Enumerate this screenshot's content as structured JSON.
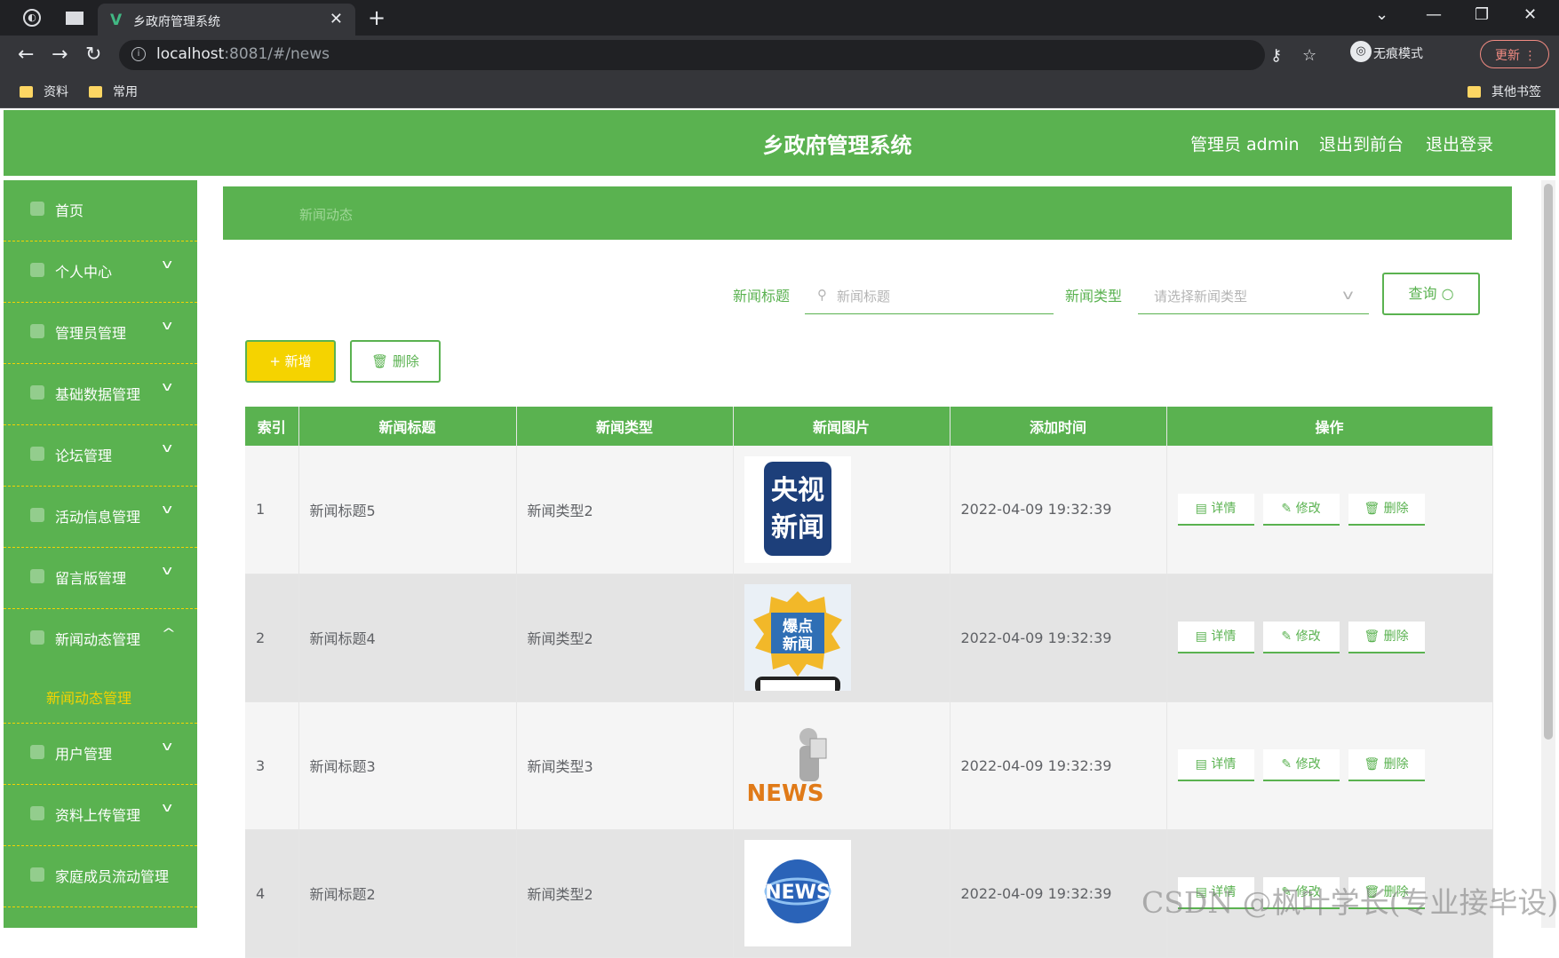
{
  "browser": {
    "tab_title": "乡政府管理系统",
    "url_host": "localhost",
    "url_rest": ":8081/#/news",
    "incognito_label": "无痕模式",
    "update_label": "更新",
    "bookmarks": [
      "资料",
      "常用"
    ],
    "other_bookmarks": "其他书签"
  },
  "header": {
    "title": "乡政府管理系统",
    "admin_label": "管理员 admin",
    "front_label": "退出到前台",
    "logout_label": "退出登录"
  },
  "sidebar": {
    "items": [
      {
        "label": "首页"
      },
      {
        "label": "个人中心"
      },
      {
        "label": "管理员管理"
      },
      {
        "label": "基础数据管理"
      },
      {
        "label": "论坛管理"
      },
      {
        "label": "活动信息管理"
      },
      {
        "label": "留言版管理"
      },
      {
        "label": "新闻动态管理"
      },
      {
        "label": "用户管理"
      },
      {
        "label": "资料上传管理"
      },
      {
        "label": "家庭成员流动管理"
      }
    ],
    "sub_item": "新闻动态管理"
  },
  "breadcrumb": "新闻动态",
  "search": {
    "title_label": "新闻标题",
    "title_placeholder": "新闻标题",
    "type_label": "新闻类型",
    "type_placeholder": "请选择新闻类型",
    "query_label": "查询"
  },
  "actions": {
    "add_label": "+ 新增",
    "delete_label": "删除"
  },
  "table": {
    "headers": [
      "索引",
      "新闻标题",
      "新闻类型",
      "新闻图片",
      "添加时间",
      "操作"
    ],
    "rows": [
      {
        "index": "1",
        "title": "新闻标题5",
        "type": "新闻类型2",
        "image": "央视新闻",
        "time": "2022-04-09 19:32:39"
      },
      {
        "index": "2",
        "title": "新闻标题4",
        "type": "新闻类型2",
        "image": "爆点新闻",
        "time": "2022-04-09 19:32:39"
      },
      {
        "index": "3",
        "title": "新闻标题3",
        "type": "新闻类型3",
        "image": "NEWS",
        "time": "2022-04-09 19:32:39"
      },
      {
        "index": "4",
        "title": "新闻标题2",
        "type": "新闻类型2",
        "image": "NEWS",
        "time": "2022-04-09 19:32:39"
      }
    ],
    "op_detail": "详情",
    "op_edit": "修改",
    "op_delete": "删除"
  },
  "watermark": "CSDN @枫叶学长(专业接毕设)",
  "colors": {
    "primary": "#5ab250",
    "accent": "#f5d300"
  }
}
